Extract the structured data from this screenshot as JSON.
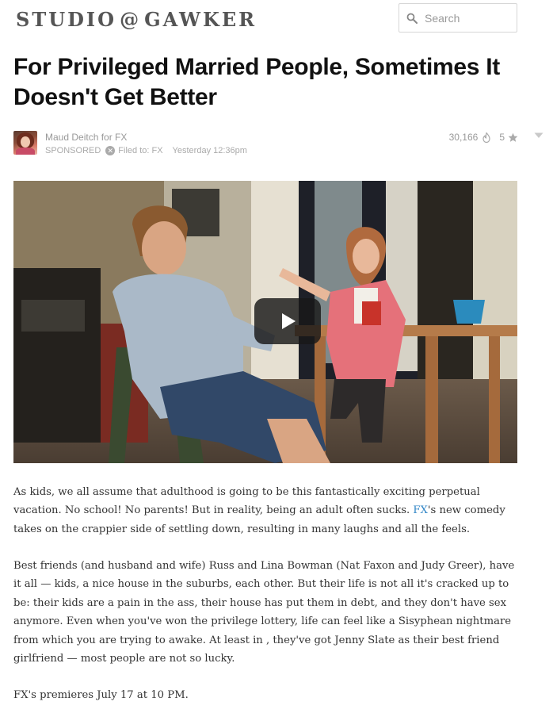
{
  "site": {
    "logo_left": "STUDIO",
    "logo_at": "@",
    "logo_right": "GAWKER"
  },
  "search": {
    "placeholder": "Search",
    "icon": "search-icon"
  },
  "article": {
    "title": "For Privileged Married People, Sometimes It Doesn't Get Better",
    "author": "Maud Deitch for FX",
    "sponsored": "SPONSORED",
    "filed_to": "Filed to: FX",
    "timestamp": "Yesterday 12:36pm",
    "views": "30,166",
    "stars": "5",
    "video": {
      "play_icon": "play-icon"
    },
    "p1": {
      "before": "As kids, we all assume that adulthood is going to be this fantastically exciting perpetual vacation. No school! No parents! But in reality, being an adult often sucks. ",
      "link": "FX",
      "after": "'s new comedy takes on the crappier side of settling down, resulting in many laughs and all the feels."
    },
    "p2": "Best friends (and husband and wife) Russ and Lina Bowman (Nat Faxon and Judy Greer), have it all — kids, a nice house in the suburbs, each other. But their life is not all it's cracked up to be: their kids are a pain in the ass, their house has put them in debt, and they don't have sex anymore. Even when you've won the privilege lottery, life can feel like a Sisyphean nightmare from which you are trying to awake. At least in , they've got Jenny Slate as their best friend girlfriend — most people are not so lucky.",
    "p3": "FX's premieres July 17 at 10 PM."
  },
  "colors": {
    "link": "#2f85c6",
    "logo": "#555555",
    "meta": "#999999"
  }
}
